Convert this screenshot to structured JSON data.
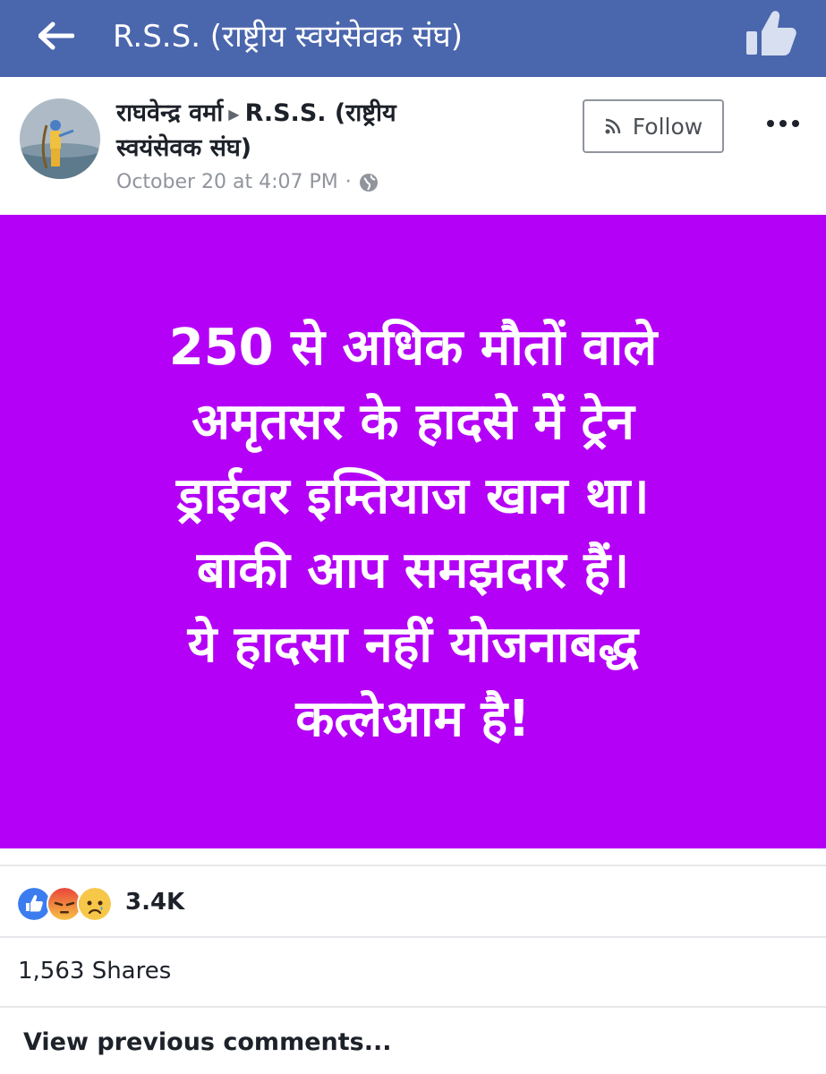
{
  "app_bar": {
    "back_icon": "arrow-left-icon",
    "title": "R.S.S. (राष्ट्रीय स्वयंसेवक संघ)",
    "like_page_icon": "thumbs-up-icon",
    "background_color": "#4a66ad"
  },
  "post": {
    "author_name": "राघवेन्द्र वर्मा",
    "separator_icon": "triangle-right-icon",
    "group_line_1": "R.S.S. (राष्ट्रीय",
    "group_line_2": "स्वयंसेवक संघ)",
    "timestamp": "October 20 at 4:07 PM",
    "meta_separator": "·",
    "privacy_icon": "globe-icon",
    "follow_label": "Follow",
    "follow_icon": "rss-feed-icon",
    "more_icon": "more-horizontal-icon",
    "card_background_color": "#b400f6",
    "message_lines": [
      "250 से अधिक मौतों वाले",
      "अमृतसर के हादसे में ट्रेन",
      "ड्राईवर इम्तियाज खान था।",
      "बाकी आप समझदार हैं।",
      "ये हादसा नहीं योजनाबद्ध",
      "कत्लेआम है!"
    ]
  },
  "engagement": {
    "reaction_icons": [
      "like-reaction-icon",
      "angry-reaction-icon",
      "sad-reaction-icon"
    ],
    "reaction_count": "3.4K",
    "shares": "1,563 Shares",
    "view_comments": "View previous comments..."
  }
}
